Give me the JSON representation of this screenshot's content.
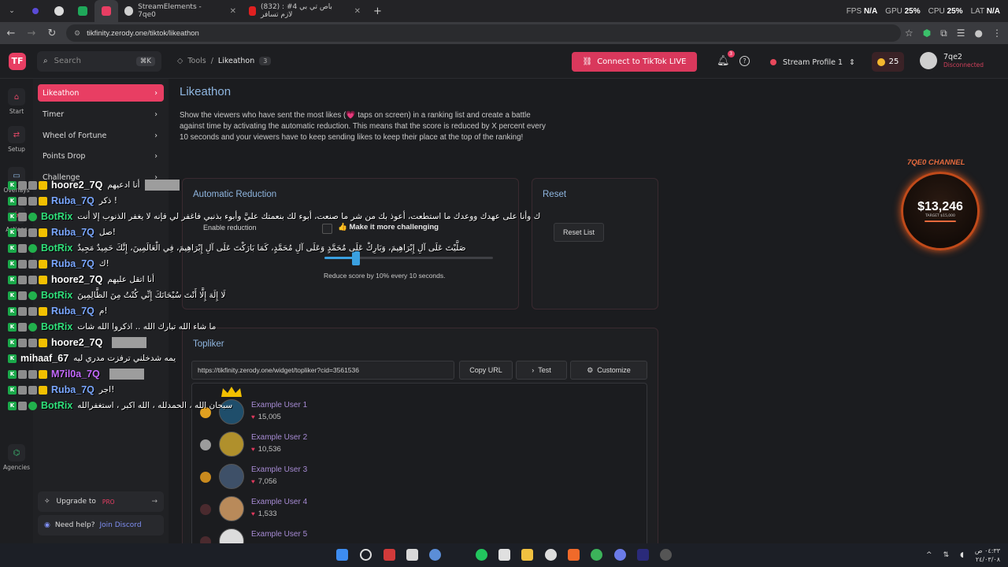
{
  "browser": {
    "tabs": [
      {
        "label": "StreamElements - 7qe0"
      },
      {
        "label": "(832) باص تي بي 4# : لازم تسافر"
      }
    ],
    "new_tab": "+",
    "url": "tikfinity.zerody.one/tiktok/likeathon",
    "stats": {
      "fps_label": "FPS",
      "fps_value": "N/A",
      "gpu_label": "GPU",
      "gpu_value": "25%",
      "cpu_label": "CPU",
      "cpu_value": "25%",
      "lat_label": "LAT",
      "lat_value": "N/A"
    }
  },
  "header": {
    "search_placeholder": "Search",
    "search_shortcut": "⌘K",
    "breadcrumb": [
      "Tools",
      "Likeathon"
    ],
    "breadcrumb_badge": "3",
    "connect_label": "Connect to TikTok LIVE",
    "notification_count": "3",
    "profile_label": "Stream Profile 1",
    "coins": "25",
    "username": "7qe2",
    "user_status": "Disconnected"
  },
  "rail": [
    {
      "label": "Start",
      "icon": "home-icon"
    },
    {
      "label": "Setup",
      "icon": "setup-icon"
    },
    {
      "label": "Overlays",
      "icon": "monitor-icon"
    },
    {
      "label": "Actions",
      "icon": "bolt-icon"
    },
    {
      "label": "Agencies",
      "icon": "agency-icon"
    }
  ],
  "subnav": {
    "items": [
      {
        "label": "Likeathon"
      },
      {
        "label": "Timer"
      },
      {
        "label": "Wheel of Fortune"
      },
      {
        "label": "Points Drop"
      },
      {
        "label": "Challenge"
      }
    ],
    "upgrade_label": "Upgrade to",
    "upgrade_pro": "PRO",
    "help_label": "Need help?",
    "help_link": "Join Discord"
  },
  "main": {
    "title": "Likeathon",
    "description": "Show the viewers who have sent the most likes (💗 taps on screen) in a ranking list and create a battle against time by activating the automatic reduction. This means that the score is reduced by X percent every 10 seconds and your viewers have to keep sending likes to keep their place at the top of the ranking!",
    "auto_reduction": {
      "title": "Automatic Reduction",
      "enable_label": "Enable reduction",
      "challenge_label": "👍 Make it more challenging",
      "slider_value_percent": 10,
      "slider_text": "Reduce score by 10% every 10 seconds."
    },
    "reset": {
      "title": "Reset",
      "button": "Reset List"
    },
    "topliker": {
      "title": "Topliker",
      "widget_url": "https://tikfinity.zerody.one/widget/topliker?cid=3561536",
      "copy_button": "Copy URL",
      "test_button": "Test",
      "customize_button": "Customize",
      "ranking": [
        {
          "name": "Example User 1",
          "likes": "15,005"
        },
        {
          "name": "Example User 2",
          "likes": "10,536"
        },
        {
          "name": "Example User 3",
          "likes": "7,056"
        },
        {
          "name": "Example User 4",
          "likes": "1,533"
        },
        {
          "name": "Example User 5",
          "likes": ""
        }
      ]
    }
  },
  "channel_widget": {
    "title": "7QE0 CHANNEL",
    "amount": "$13,246",
    "target": "TARGET $15,000"
  },
  "chat": [
    {
      "name": "hoore2_7Q",
      "msg": "أنا ادعيهم",
      "cls": "n-hoore",
      "badges": [
        "k",
        "g",
        "g",
        "c"
      ],
      "emote": true
    },
    {
      "name": "Ruba_7Q",
      "msg": "ذكر !",
      "cls": "n-ruba",
      "badges": [
        "k",
        "g",
        "g",
        "c"
      ],
      "emote": false
    },
    {
      "name": "BotRix",
      "msg": "ك وأنا على عهدك ووعدك ما استطعت، أعوذ بك من شر ما صنعت، أبوء لك بنعمتك عليَّ وأبوء بذنبي فاغفر لي فإنه لا يغفر الذنوب إلا أنت",
      "cls": "n-bot",
      "badges": [
        "k",
        "g",
        "v"
      ],
      "emote": false
    },
    {
      "name": "Ruba_7Q",
      "msg": "صل!",
      "cls": "n-ruba",
      "badges": [
        "k",
        "g",
        "g",
        "c"
      ],
      "emote": false
    },
    {
      "name": "BotRix",
      "msg": "صَلَّيْتَ عَلَى آلِ إِبْرَاهِيمَ، وَبَارِكْ عَلَى مُحَمَّدٍ وَعَلَى آلِ مُحَمَّدٍ، كَمَا بَارَكْتَ عَلَى آلِ إِبْرَاهِيمَ، فِي الْعَالَمِينَ، إِنَّكَ حَمِيدٌ مَجِيدٌ",
      "cls": "n-bot",
      "badges": [
        "k",
        "g",
        "v"
      ],
      "emote": false
    },
    {
      "name": "Ruba_7Q",
      "msg": "ك!",
      "cls": "n-ruba",
      "badges": [
        "k",
        "g",
        "g",
        "c"
      ],
      "emote": false
    },
    {
      "name": "hoore2_7Q",
      "msg": "أنا اتقل عليهم",
      "cls": "n-hoore",
      "badges": [
        "k",
        "g",
        "g",
        "c"
      ],
      "emote": false
    },
    {
      "name": "BotRix",
      "msg": "لَا إِلَهَ إِلَّا أَنْتَ سُبْحَانَكَ إِنِّي كُنْتُ مِنَ الظَّالِمِينَ",
      "cls": "n-bot",
      "badges": [
        "k",
        "g",
        "v"
      ],
      "emote": false
    },
    {
      "name": "Ruba_7Q",
      "msg": "م!",
      "cls": "n-ruba",
      "badges": [
        "k",
        "g",
        "g",
        "c"
      ],
      "emote": false
    },
    {
      "name": "BotRix",
      "msg": "ما شاء الله تبارك الله .. اذكروا الله شات",
      "cls": "n-bot",
      "badges": [
        "k",
        "g",
        "v"
      ],
      "emote": false
    },
    {
      "name": "hoore2_7Q",
      "msg": "",
      "cls": "n-hoore",
      "badges": [
        "k",
        "g",
        "g",
        "c"
      ],
      "emote": true
    },
    {
      "name": "mihaaf_67",
      "msg": "يمه شدخلني ترفزت مدري ليه",
      "cls": "n-mih",
      "badges": [
        "k"
      ],
      "emote": false
    },
    {
      "name": "M7il0a_7Q",
      "msg": "",
      "cls": "n-m7",
      "badges": [
        "k",
        "g",
        "g",
        "c"
      ],
      "emote": true
    },
    {
      "name": "Ruba_7Q",
      "msg": "اجر!",
      "cls": "n-ruba",
      "badges": [
        "k",
        "g",
        "g",
        "c"
      ],
      "emote": false
    },
    {
      "name": "BotRix",
      "msg": "سبحان الله ، الحمدلله ، الله اكبر ، استغفرالله",
      "cls": "n-bot",
      "badges": [
        "k",
        "g",
        "v"
      ],
      "emote": false
    }
  ],
  "taskbar": {
    "time": "٠٤:٣٣ ص",
    "date": "٢٤/٠٣/٠٨"
  }
}
